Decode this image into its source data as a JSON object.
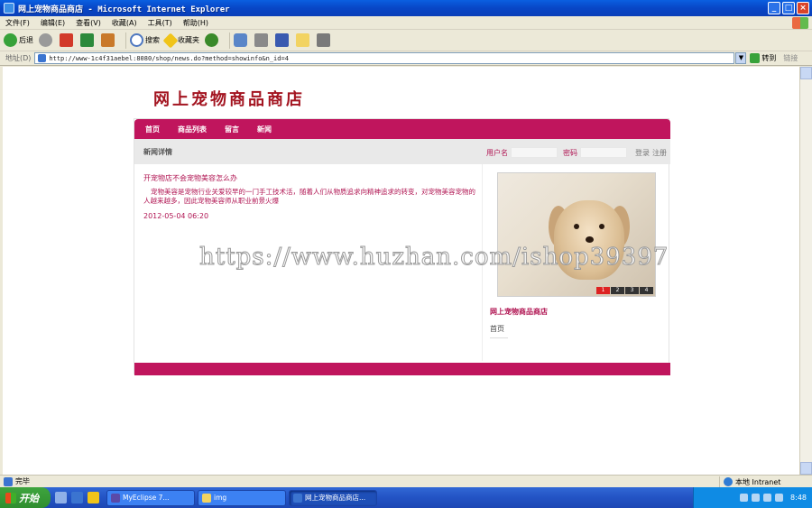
{
  "window": {
    "title": "网上宠物商品商店 - Microsoft Internet Explorer",
    "controls": {
      "minimize": "_",
      "maximize": "□",
      "close": "×"
    }
  },
  "menubar": {
    "items": [
      "文件(F)",
      "编辑(E)",
      "查看(V)",
      "收藏(A)",
      "工具(T)",
      "帮助(H)"
    ]
  },
  "toolbar": {
    "back_label": "后退",
    "search_label": "搜索",
    "favorites_label": "收藏夹"
  },
  "addressbar": {
    "label": "地址(D)",
    "url": "http://www-1c4f31aebel:8080/shop/news.do?method=showinfo&n_id=4",
    "go_label": "转到",
    "links_label": "链接"
  },
  "page": {
    "shop_title": "网上宠物商品商店",
    "nav": [
      "首页",
      "商品列表",
      "留言",
      "新闻"
    ],
    "breadcrumb": "新闻详情",
    "login": {
      "username_label": "用户名",
      "password_label": "密码",
      "login_label": "登录",
      "register_label": "注册"
    },
    "news": {
      "title": "开宠物店不会宠物美容怎么办",
      "body": "宠物美容是宠物行业关爱较早的一门手工技术活，随着人们从物质追求向精神追求的转变，对宠物美容宠物的人越来越多，因此宠物美容师从职业前景火爆",
      "date": "2012-05-04 06:20"
    },
    "slideshow": {
      "dots": [
        "1",
        "2",
        "3",
        "4"
      ],
      "active_index": 0
    },
    "sidebar": {
      "title": "网上宠物商品商店",
      "link": "首页"
    },
    "watermark": "https://www.huzhan.com/ishop39397",
    "colors": {
      "brand": "#c0155d",
      "title": "#a31420"
    }
  },
  "statusbar": {
    "status": "完毕",
    "zone": "本地 Intranet"
  },
  "taskbar": {
    "start_label": "开始",
    "tasks": [
      "MyEclipse 7...",
      "img",
      "网上宠物商品商店..."
    ],
    "clock": "8:48"
  }
}
